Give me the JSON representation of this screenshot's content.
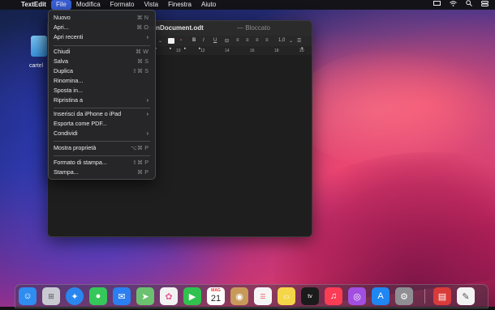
{
  "menubar": {
    "apple": "",
    "app_name": "TextEdit",
    "menus": [
      "File",
      "Modifica",
      "Formato",
      "Vista",
      "Finestra",
      "Aiuto"
    ],
    "status_icons": [
      "screen-mirroring-icon",
      "wifi-icon",
      "search-icon",
      "control-center-icon"
    ]
  },
  "desktop": {
    "folder_label": "cartel"
  },
  "window": {
    "title": "o-OpenDocument.odt",
    "status": "— Bloccato",
    "toolbar": {
      "bold": "B",
      "italic": "I",
      "underline": "U",
      "spacing": "1,0"
    },
    "ruler_labels": [
      "10",
      "12",
      "14",
      "16",
      "18",
      "20"
    ]
  },
  "file_menu": {
    "items": [
      {
        "label": "Nuovo",
        "shortcut": "⌘ N"
      },
      {
        "label": "Apri...",
        "shortcut": "⌘ O"
      },
      {
        "label": "Apri recenti",
        "submenu": "›"
      },
      {
        "label": "Chiudi",
        "shortcut": "⌘ W"
      },
      {
        "label": "Salva",
        "shortcut": "⌘ S"
      },
      {
        "label": "Duplica",
        "shortcut": "⇧⌘ S"
      },
      {
        "label": "Rinomina..."
      },
      {
        "label": "Sposta in..."
      },
      {
        "label": "Ripristina a",
        "submenu": "›"
      },
      {
        "label": "Inserisci da iPhone o iPad",
        "submenu": "›"
      },
      {
        "label": "Esporta come PDF..."
      },
      {
        "label": "Condividi",
        "submenu": "›"
      },
      {
        "label": "Mostra proprietà",
        "shortcut": "⌥⌘ P"
      },
      {
        "label": "Formato di stampa...",
        "shortcut": "⇧⌘ P"
      },
      {
        "label": "Stampa...",
        "shortcut": "⌘ P"
      }
    ]
  },
  "dock": {
    "calendar_month": "MAG",
    "calendar_day": "21",
    "apple_tv_label": "tv",
    "colors": {
      "finder": "#2f8cf0",
      "launchpad": "#c9c9d2",
      "safari": "#2a86ef",
      "messages": "#35c759",
      "mail": "#2b7ff0",
      "maps": "#6bc16f",
      "photos": "#f2f2f2",
      "facetime": "#30c24e",
      "calendar": "#ffffff",
      "contacts": "#c79a5a",
      "reminders": "#f5f5f5",
      "notes": "#f5d648",
      "tv": "#1b1b1b",
      "music": "#fa3c55",
      "podcasts": "#a24ee0",
      "appstore": "#1f86f2",
      "settings": "#8e8e93",
      "textedit_recent": "#d93a3a",
      "textedit": "#f2f2f2",
      "trash": "#9aa0a8"
    }
  }
}
